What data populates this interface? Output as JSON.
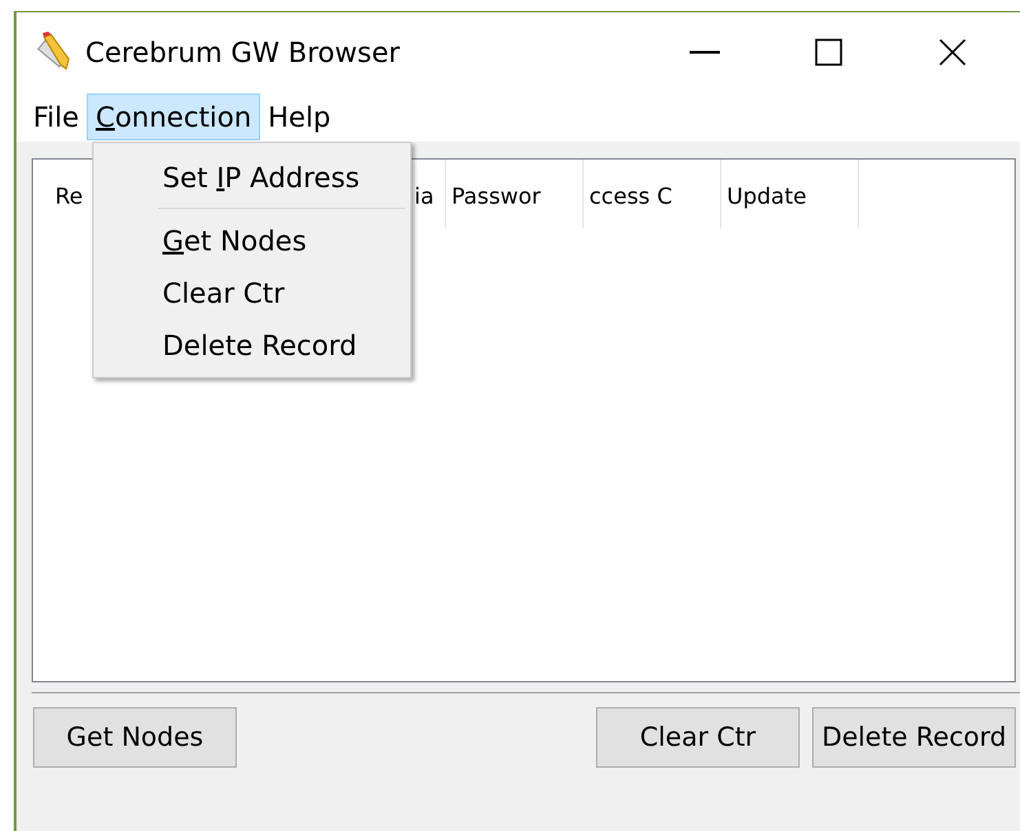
{
  "window": {
    "title": "Cerebrum GW Browser"
  },
  "menu": [
    {
      "label": "File",
      "selected": false
    },
    {
      "parts": [
        {
          "text": "C",
          "underline": true
        },
        {
          "text": "onnection",
          "underline": false
        }
      ],
      "selected": true
    },
    {
      "label": "Help",
      "selected": false
    }
  ],
  "dropdown": [
    {
      "kind": "item",
      "parts": [
        {
          "text": "Set ",
          "underline": false
        },
        {
          "text": "I",
          "underline": true
        },
        {
          "text": "P Address",
          "underline": false
        }
      ]
    },
    {
      "kind": "separator"
    },
    {
      "kind": "item",
      "parts": [
        {
          "text": "G",
          "underline": true
        },
        {
          "text": "et Nodes",
          "underline": false
        }
      ]
    },
    {
      "kind": "item",
      "label": "Clear Ctr"
    },
    {
      "kind": "item",
      "label": "Delete Record"
    }
  ],
  "table": {
    "columns": [
      {
        "label": "Re",
        "kind": "left"
      },
      {
        "label": "ia",
        "kind": "after-menu"
      },
      {
        "label": "Passwor"
      },
      {
        "label": "ccess C"
      },
      {
        "label": "Update"
      }
    ]
  },
  "buttons_left": [
    {
      "label": "Get Nodes"
    }
  ],
  "buttons_right": [
    {
      "label": "Clear Ctr"
    },
    {
      "label": "Delete Record"
    }
  ]
}
